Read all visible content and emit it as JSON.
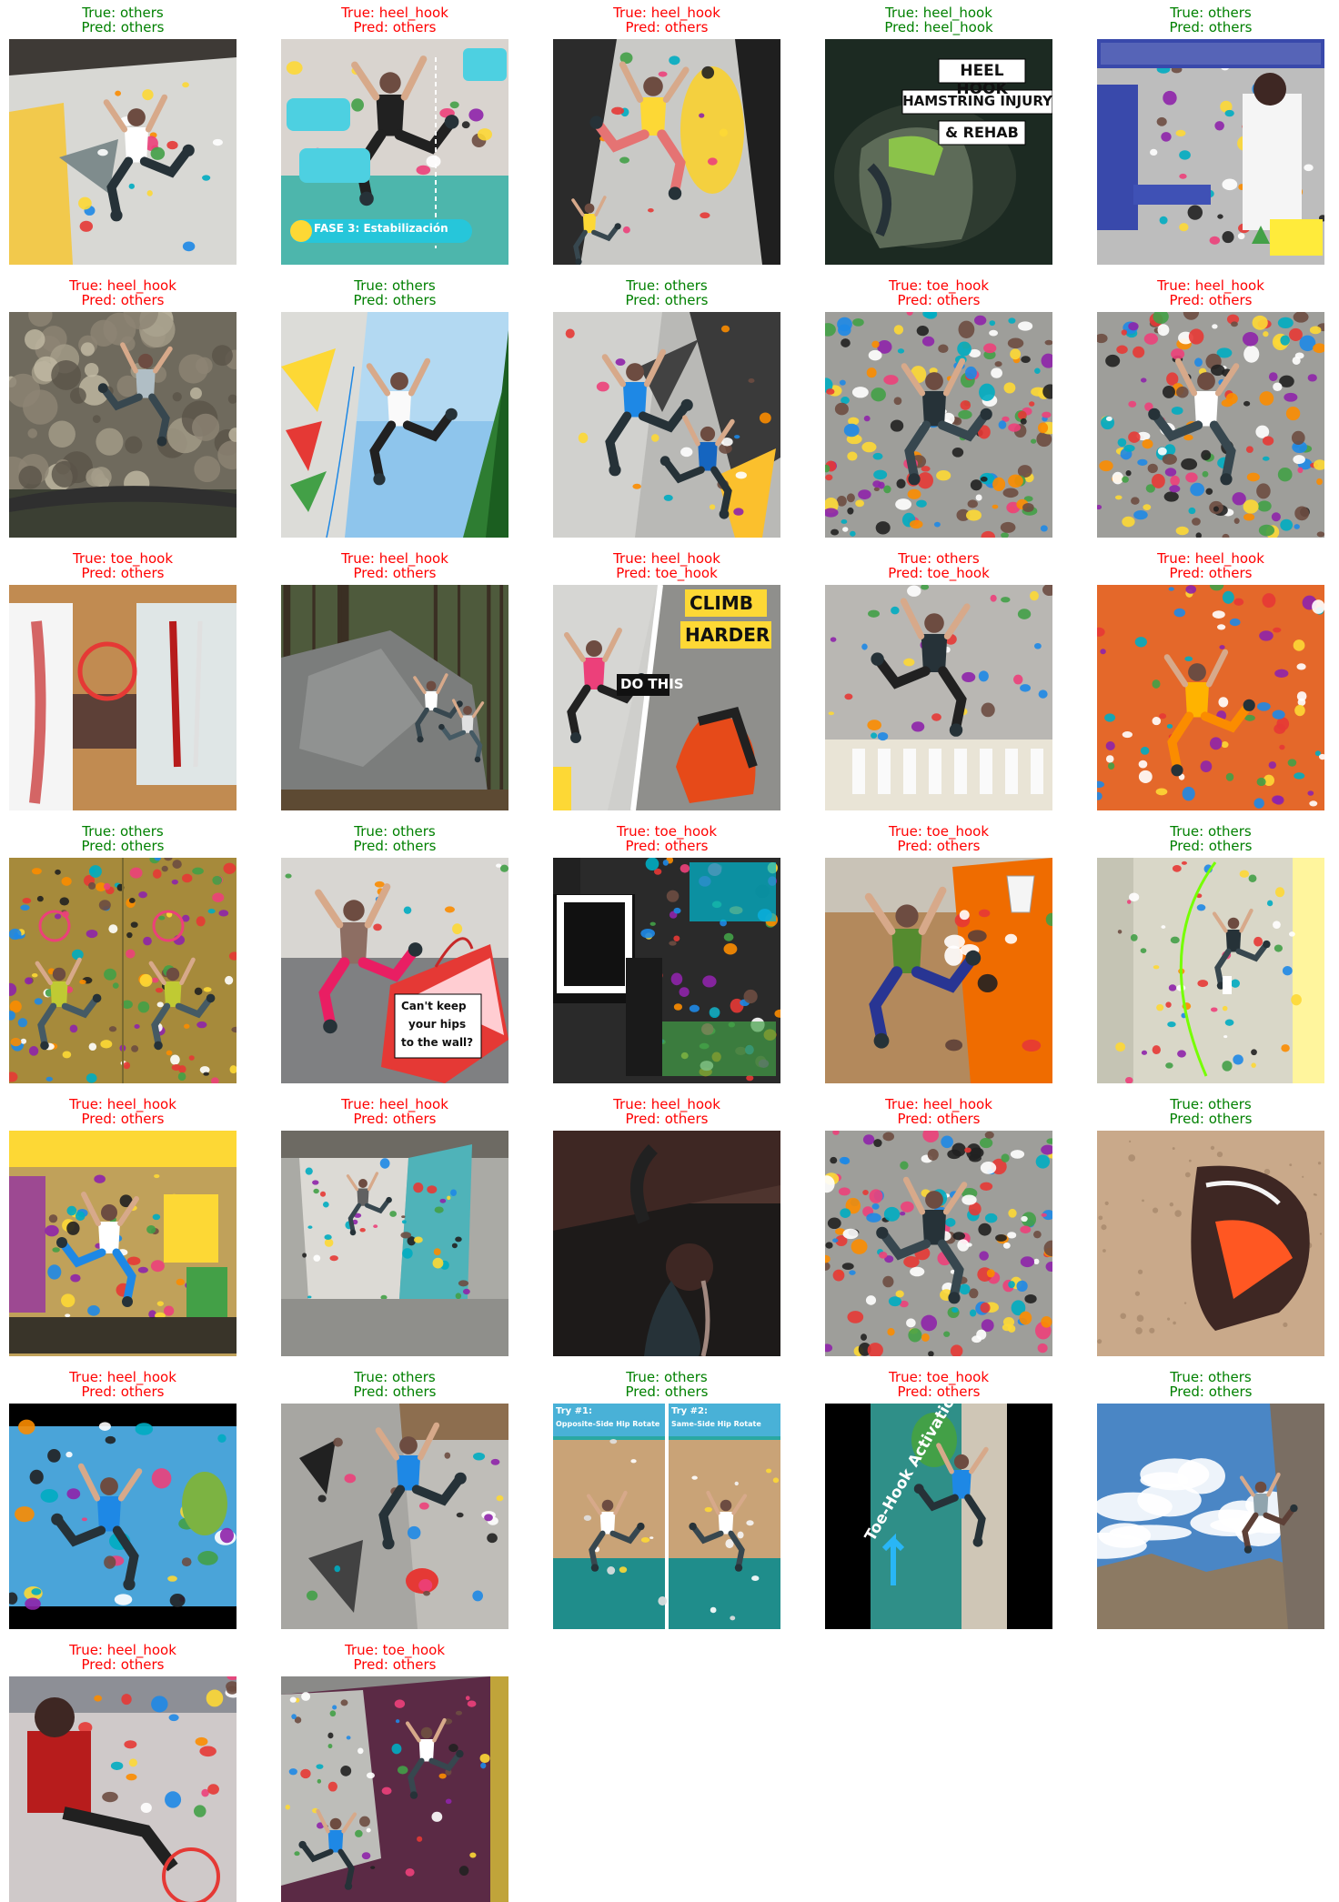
{
  "colors": {
    "correct": "#008000",
    "incorrect": "#ff0000"
  },
  "cells": [
    {
      "true": "True: others",
      "pred": "Pred: others",
      "correct": true,
      "scene": "gym-grey-yellow",
      "overlay": []
    },
    {
      "true": "True: heel_hook",
      "pred": "Pred: others",
      "correct": false,
      "scene": "gym-teal-infographic",
      "overlay": [
        "FASE 3: Estabilización"
      ]
    },
    {
      "true": "True: heel_hook",
      "pred": "Pred: others",
      "correct": false,
      "scene": "gym-grey-yellow-volume",
      "overlay": []
    },
    {
      "true": "True: heel_hook",
      "pred": "Pred: heel_hook",
      "correct": true,
      "scene": "closeup-shoe",
      "overlay": [
        "HEEL HOOK",
        "HAMSTRING INJURY",
        "& REHAB"
      ]
    },
    {
      "true": "True: others",
      "pred": "Pred: others",
      "correct": true,
      "scene": "gym-jp-thumbnail",
      "overlay": []
    },
    {
      "true": "True: heel_hook",
      "pred": "Pred: others",
      "correct": false,
      "scene": "outdoor-cave",
      "overlay": []
    },
    {
      "true": "True: others",
      "pred": "Pred: others",
      "correct": true,
      "scene": "sky-lead",
      "overlay": []
    },
    {
      "true": "True: others",
      "pred": "Pred: others",
      "correct": true,
      "scene": "gym-comp",
      "overlay": []
    },
    {
      "true": "True: toe_hook",
      "pred": "Pred: others",
      "correct": false,
      "scene": "gym-holds-dense",
      "overlay": []
    },
    {
      "true": "True: heel_hook",
      "pred": "Pred: others",
      "correct": false,
      "scene": "gym-holds-dense",
      "overlay": []
    },
    {
      "true": "True: toe_hook",
      "pred": "Pred: others",
      "correct": false,
      "scene": "anatomy",
      "overlay": []
    },
    {
      "true": "True: heel_hook",
      "pred": "Pred: others",
      "correct": false,
      "scene": "outdoor-boulder",
      "overlay": []
    },
    {
      "true": "True: heel_hook",
      "pred": "Pred: toe_hook",
      "correct": false,
      "scene": "split-climb-harder",
      "overlay": [
        "CLIMB",
        "HARDER",
        "DO THIS"
      ]
    },
    {
      "true": "True: others",
      "pred": "Pred: toe_hook",
      "correct": false,
      "scene": "gym-grey-outdoor",
      "overlay": []
    },
    {
      "true": "True: heel_hook",
      "pred": "Pred: others",
      "correct": false,
      "scene": "gym-orange",
      "overlay": []
    },
    {
      "true": "True: others",
      "pred": "Pred: others",
      "correct": true,
      "scene": "gym-double",
      "overlay": []
    },
    {
      "true": "True: others",
      "pred": "Pred: others",
      "correct": true,
      "scene": "gym-red-volume",
      "overlay": [
        "Can't keep",
        "your hips",
        "to the wall?"
      ]
    },
    {
      "true": "True: toe_hook",
      "pred": "Pred: others",
      "correct": false,
      "scene": "jp-dark",
      "overlay": []
    },
    {
      "true": "True: toe_hook",
      "pred": "Pred: others",
      "correct": false,
      "scene": "gym-orange-wood",
      "overlay": []
    },
    {
      "true": "True: others",
      "pred": "Pred: others",
      "correct": true,
      "scene": "gym-vertical-light",
      "overlay": []
    },
    {
      "true": "True: heel_hook",
      "pred": "Pred: others",
      "correct": false,
      "scene": "jp-yellow",
      "overlay": []
    },
    {
      "true": "True: heel_hook",
      "pred": "Pred: others",
      "correct": false,
      "scene": "gym-teal-box",
      "overlay": []
    },
    {
      "true": "True: heel_hook",
      "pred": "Pred: others",
      "correct": false,
      "scene": "dark-overhang",
      "overlay": []
    },
    {
      "true": "True: heel_hook",
      "pred": "Pred: others",
      "correct": false,
      "scene": "gym-holds-dense",
      "overlay": []
    },
    {
      "true": "True: others",
      "pred": "Pred: others",
      "correct": true,
      "scene": "closeup-rock-shoe",
      "overlay": []
    },
    {
      "true": "True: heel_hook",
      "pred": "Pred: others",
      "correct": false,
      "scene": "gym-blue-letterbox",
      "overlay": []
    },
    {
      "true": "True: others",
      "pred": "Pred: others",
      "correct": true,
      "scene": "gym-grey-volume2",
      "overlay": []
    },
    {
      "true": "True: others",
      "pred": "Pred: others",
      "correct": true,
      "scene": "split-teal",
      "overlay": [
        "Try #1:",
        "Opposite-Side Hip Rotate",
        "Try #2:",
        "Same-Side Hip Rotate"
      ]
    },
    {
      "true": "True: toe_hook",
      "pred": "Pred: others",
      "correct": false,
      "scene": "teal-letterbox",
      "overlay": [
        "Toe-Hook Activation"
      ]
    },
    {
      "true": "True: others",
      "pred": "Pred: others",
      "correct": true,
      "scene": "outdoor-sky-cliff",
      "overlay": []
    },
    {
      "true": "True: heel_hook",
      "pred": "Pred: others",
      "correct": false,
      "scene": "gym-red-shirt",
      "overlay": []
    },
    {
      "true": "True: toe_hook",
      "pred": "Pred: others",
      "correct": false,
      "scene": "gym-purple",
      "overlay": []
    }
  ]
}
